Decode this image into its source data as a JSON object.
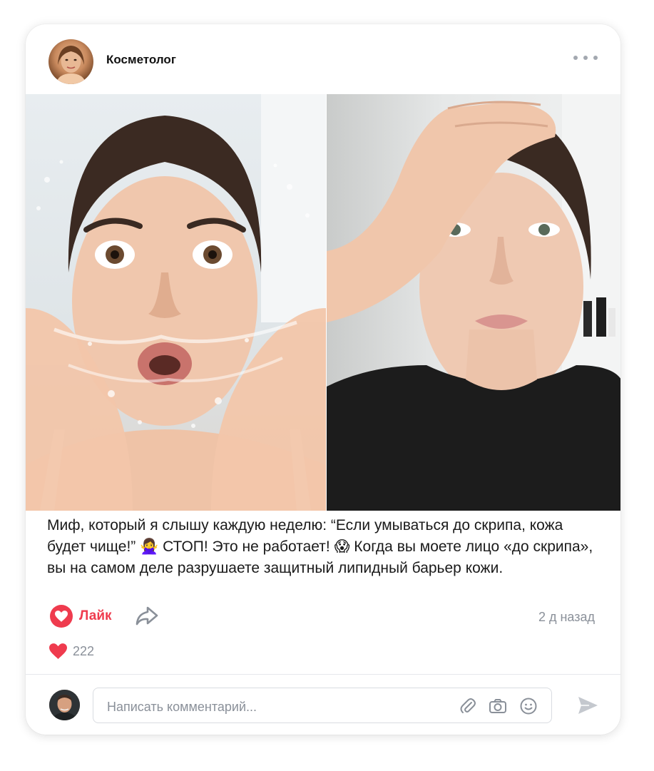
{
  "post": {
    "author_name": "Косметолог",
    "text": "Миф, который я слышу каждую неделю: “Если умываться до скрипа, кожа будет чище!” 🙅‍♀️ СТОП! Это не работает! 😱 Когда вы моете лицо «до скрипа», вы на самом деле разрушаете защитный липидный барьер кожи.",
    "like_label": "Лайк",
    "time_ago": "2 д назад",
    "likes_count": "222"
  },
  "comment": {
    "placeholder": "Написать комментарий..."
  },
  "icons": {
    "more": "more-dots-icon",
    "like": "heart-icon",
    "share": "share-arrow-icon",
    "attach": "paperclip-icon",
    "camera": "camera-icon",
    "emoji": "smile-icon",
    "send": "send-icon"
  },
  "colors": {
    "accent_red": "#ef3b4e",
    "muted_text": "#8a9099"
  }
}
